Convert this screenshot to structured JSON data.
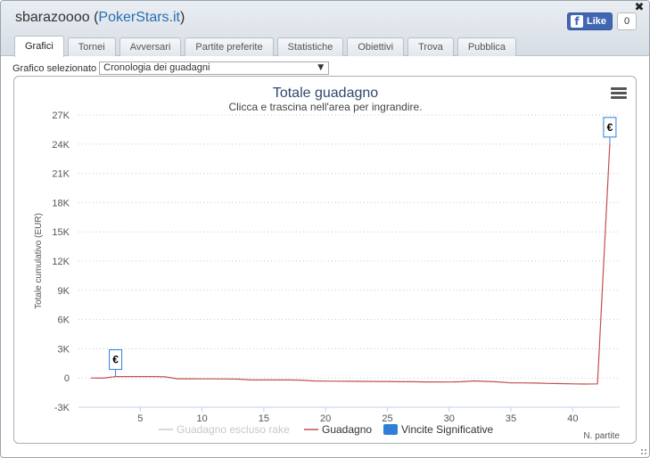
{
  "window": {
    "title": "sbarazoooo",
    "title_link": "PokerStars.it",
    "close_glyph": "✖"
  },
  "facebook": {
    "like_label": "Like",
    "count": "0",
    "logo_glyph": "f"
  },
  "tabs": [
    {
      "label": "Grafici",
      "active": true
    },
    {
      "label": "Tornei",
      "active": false
    },
    {
      "label": "Avversari",
      "active": false
    },
    {
      "label": "Partite preferite",
      "active": false
    },
    {
      "label": "Statistiche",
      "active": false
    },
    {
      "label": "Obiettivi",
      "active": false
    },
    {
      "label": "Trova",
      "active": false
    },
    {
      "label": "Pubblica",
      "active": false
    }
  ],
  "selector": {
    "label": "Grafico selezionato",
    "value": "Cronologia dei guadagni",
    "arrow": "▼"
  },
  "colors": {
    "gain_line": "#c0504d",
    "excluded_line": "#cccccc",
    "wins_marker": "#2f7ed8",
    "title": "#2d4a6b"
  },
  "chart_data": {
    "type": "line",
    "title": "Totale guadagno",
    "subtitle": "Clicca e trascina nell'area per ingrandire.",
    "ylabel": "Totale cumulativo (EUR)",
    "xlabel": "N. partite",
    "ylim": [
      -3000,
      27000
    ],
    "xlim": [
      0,
      43.8
    ],
    "y_ticks": [
      {
        "value": -3000,
        "label": "-3K"
      },
      {
        "value": 0,
        "label": "0"
      },
      {
        "value": 3000,
        "label": "3K"
      },
      {
        "value": 6000,
        "label": "6K"
      },
      {
        "value": 9000,
        "label": "9K"
      },
      {
        "value": 12000,
        "label": "12K"
      },
      {
        "value": 15000,
        "label": "15K"
      },
      {
        "value": 18000,
        "label": "18K"
      },
      {
        "value": 21000,
        "label": "21K"
      },
      {
        "value": 24000,
        "label": "24K"
      },
      {
        "value": 27000,
        "label": "27K"
      }
    ],
    "x_ticks": [
      5,
      10,
      15,
      20,
      25,
      30,
      35,
      40
    ],
    "grid": true,
    "legend_position": "bottom",
    "legend": [
      {
        "name": "Guadagno escluso rake",
        "kind": "line",
        "color": "#cccccc",
        "dim": true
      },
      {
        "name": "Guadagno",
        "kind": "line",
        "color": "#c0504d",
        "dim": false
      },
      {
        "name": "Vincite Significative",
        "kind": "box",
        "color": "#2f7ed8",
        "dim": false
      }
    ],
    "series": [
      {
        "name": "Guadagno",
        "x": [
          1,
          2,
          3,
          4,
          5,
          6,
          7,
          8,
          9,
          10,
          11,
          12,
          13,
          14,
          15,
          16,
          17,
          18,
          19,
          20,
          21,
          22,
          23,
          24,
          25,
          26,
          27,
          28,
          29,
          30,
          31,
          32,
          33,
          34,
          35,
          36,
          37,
          38,
          39,
          40,
          41,
          42,
          43
        ],
        "y": [
          0,
          -20,
          150,
          150,
          150,
          150,
          120,
          -80,
          -80,
          -90,
          -90,
          -100,
          -120,
          -200,
          -200,
          -200,
          -200,
          -220,
          -300,
          -320,
          -330,
          -340,
          -350,
          -360,
          -360,
          -380,
          -380,
          -400,
          -400,
          -410,
          -380,
          -300,
          -350,
          -400,
          -500,
          -500,
          -520,
          -560,
          -580,
          -600,
          -620,
          -600,
          24000
        ]
      }
    ],
    "flags": [
      {
        "x": 3,
        "y": 150,
        "text": "€"
      },
      {
        "x": 43,
        "y": 24000,
        "text": "€"
      }
    ]
  }
}
